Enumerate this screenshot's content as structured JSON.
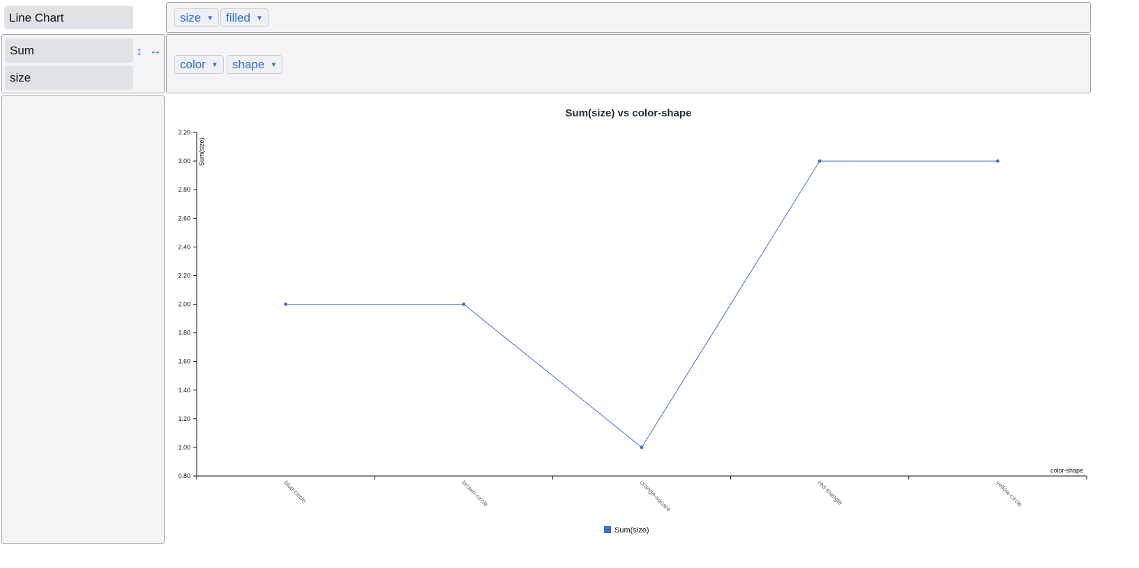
{
  "chart_type_button": "Line Chart",
  "aggregation": {
    "label": "Sum",
    "field": "size",
    "vertical_icon": "vertical-arrows-icon",
    "horizontal_icon": "horizontal-arrows-icon"
  },
  "filter_row": {
    "pills": [
      "size",
      "filled"
    ]
  },
  "group_row": {
    "pills": [
      "color",
      "shape"
    ]
  },
  "chart_data": {
    "type": "line",
    "title": "Sum(size) vs color-shape",
    "xlabel": "color-shape",
    "ylabel": "Sum(size)",
    "categories": [
      "blue-circle",
      "brown-circle",
      "orange-square",
      "red-triangle",
      "yellow-circle"
    ],
    "series": [
      {
        "name": "Sum(size)",
        "values": [
          2,
          2,
          1,
          3,
          3
        ],
        "color": "#3b6fd4"
      }
    ],
    "ylim": [
      0.8,
      3.2
    ],
    "yticks": [
      "0.80",
      "1.00",
      "1.20",
      "1.40",
      "1.60",
      "1.80",
      "2.00",
      "2.20",
      "2.40",
      "2.60",
      "2.80",
      "3.00",
      "3.20"
    ],
    "grid": false,
    "legend": "bottom-center"
  }
}
